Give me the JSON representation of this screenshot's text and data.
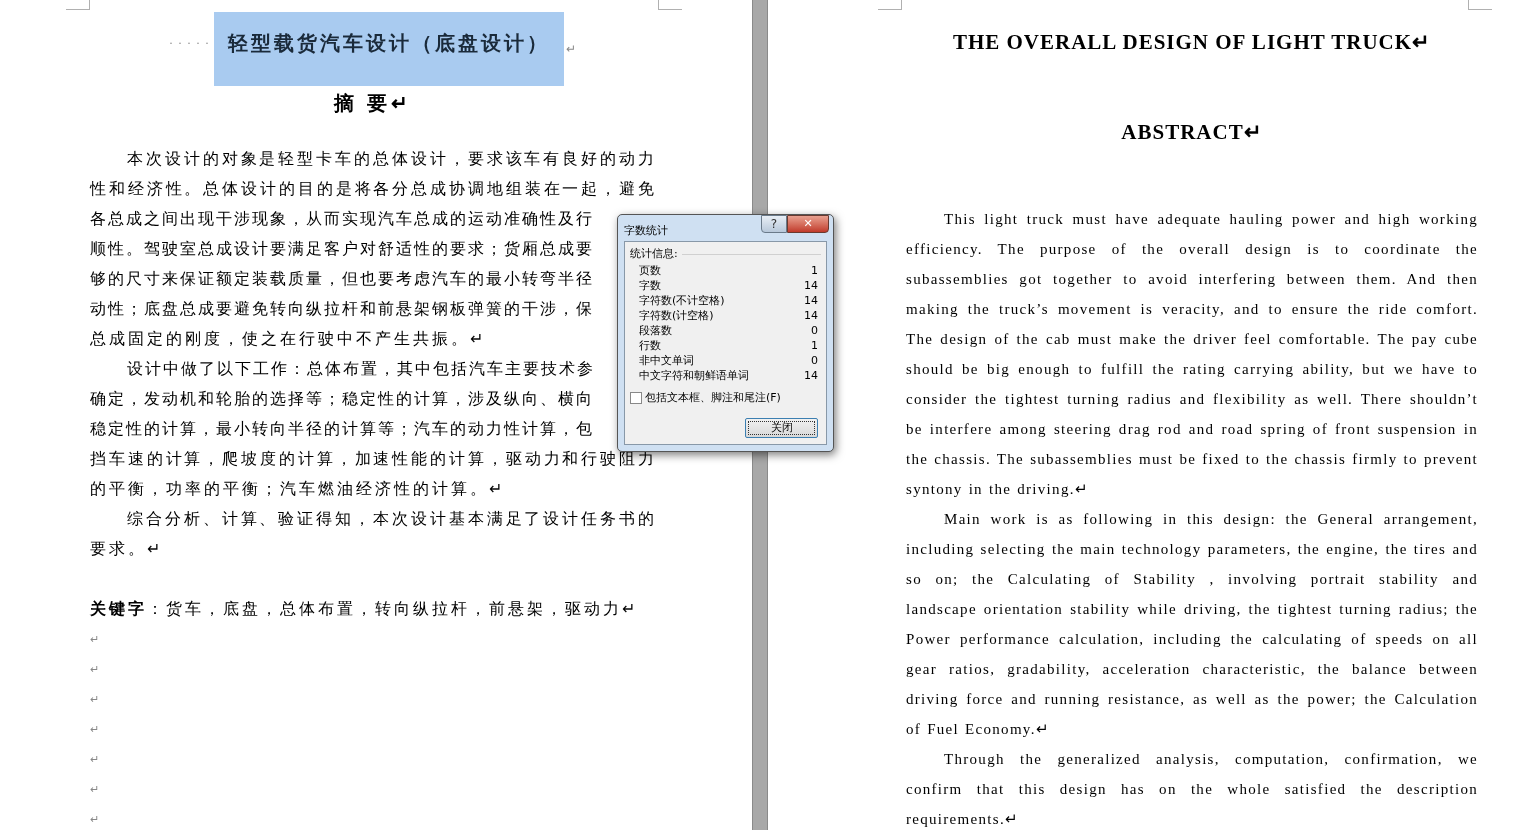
{
  "left_page": {
    "title_dots": "· · · · ·",
    "title": "轻型载货汽车设计（底盘设计）",
    "title_selected": true,
    "title_mark": "↵",
    "heading": "摘 要↵",
    "paragraphs": [
      {
        "lines": [
          {
            "text": "本次设计的对象是轻型卡车的总体设计，要求该车有良好的动力",
            "kind": "full"
          },
          {
            "text": "性和经济性。总体设计的目的是将各分总成协调地组装在一起，避免",
            "kind": "full"
          },
          {
            "text": "各总成之间出现干涉现象，从而实现汽车总成的运动准确性及行",
            "kind": "cut"
          },
          {
            "text": "顺性。驾驶室总成设计要满足客户对舒适性的要求；货厢总成要",
            "kind": "cut"
          },
          {
            "text": "够的尺寸来保证额定装载质量，但也要考虑汽车的最小转弯半径",
            "kind": "cut"
          },
          {
            "text": "动性；底盘总成要避免转向纵拉杆和前悬架钢板弹簧的干涉，保",
            "kind": "cut"
          },
          {
            "text": "总成固定的刚度，使之在行驶中不产生共振。↵",
            "kind": "end"
          }
        ]
      },
      {
        "lines": [
          {
            "text": "设计中做了以下工作：总体布置，其中包括汽车主要技术参",
            "kind": "cut"
          },
          {
            "text": "确定，发动机和轮胎的选择等；稳定性的计算，涉及纵向、横向",
            "kind": "cut"
          },
          {
            "text": "稳定性的计算，最小转向半径的计算等；汽车的动力性计算，包",
            "kind": "cut"
          },
          {
            "text": "挡车速的计算，爬坡度的计算，加速性能的计算，驱动力和行驶阻力",
            "kind": "full"
          },
          {
            "text": "的平衡，功率的平衡；汽车燃油经济性的计算。↵",
            "kind": "end"
          }
        ]
      },
      {
        "lines": [
          {
            "text": "综合分析、计算、验证得知，本次设计基本满足了设计任务书的",
            "kind": "full"
          },
          {
            "text": "要求。↵",
            "kind": "end"
          }
        ]
      }
    ],
    "keywords": "**关键字**：货车，底盘，总体布置，转向纵拉杆，前悬架，驱动力↵",
    "empty_paragraphs": [
      "↵",
      "↵",
      "↵",
      "↵",
      "↵",
      "↵",
      "↵"
    ]
  },
  "right_page": {
    "title": "THE OVERALL DESIGN OF LIGHT TRUCK↵",
    "heading": "ABSTRACT↵",
    "paragraphs": [
      "This light truck must have adequate hauling power and high working efficiency. The purpose of the overall design is to coordinate the subassemblies got together to avoid interfering between them. And then making the truck’s movement is veracity, and to ensure the ride comfort. The design of the cab must make the driver feel comfortable. The pay cube should be big enough to fulfill the rating carrying ability, but we have to consider the tightest turning radius and flexibility as well. There shouldn’t be interfere among steering drag rod and road spring of front suspension in the chassis. The subassemblies must be fixed to the chassis firmly to prevent syntony in the driving.↵",
      "Main work is as following in this design: the General arrangement, including selecting the main technology parameters, the engine, the tires and so on; the Calculating of Stability , involving portrait stability and landscape orientation stability while driving, the tightest turning radius; the Power performance calculation, including the calculating of speeds on all gear ratios, gradability, acceleration characteristic, the balance between driving force and running resistance, as well as the power; the Calculation of Fuel Economy.↵",
      "Through the generalized analysis, computation, confirmation, we confirm that this design has on the whole satisfied the description requirements.↵"
    ]
  },
  "dialog": {
    "title": "字数统计",
    "help": "?",
    "close": "✕",
    "group_label": "统计信息:",
    "stats": [
      {
        "label": "页数",
        "value": "1"
      },
      {
        "label": "字数",
        "value": "14"
      },
      {
        "label": "字符数(不计空格)",
        "value": "14"
      },
      {
        "label": "字符数(计空格)",
        "value": "14"
      },
      {
        "label": "段落数",
        "value": "0"
      },
      {
        "label": "行数",
        "value": "1"
      },
      {
        "label": "非中文单词",
        "value": "0"
      },
      {
        "label": "中文字符和朝鲜语单词",
        "value": "14"
      }
    ],
    "checkbox": {
      "label": "包括文本框、脚注和尾注(F)",
      "checked": false
    },
    "button": "关闭"
  }
}
